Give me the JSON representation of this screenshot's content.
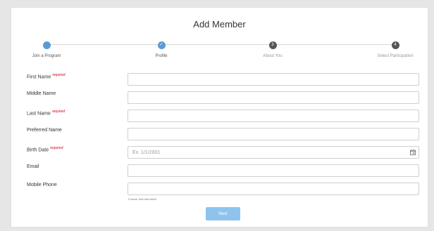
{
  "title": "Add Member",
  "steps": [
    {
      "label": "Join a Program",
      "state": "done",
      "marker": ""
    },
    {
      "label": "Profile",
      "state": "done",
      "marker": "✓"
    },
    {
      "label": "About You",
      "state": "todo",
      "marker": "3"
    },
    {
      "label": "Select Participation",
      "state": "todo",
      "marker": "4"
    }
  ],
  "form": {
    "required_text": "required",
    "fields": [
      {
        "label": "First Name",
        "value": "",
        "placeholder": ""
      },
      {
        "label": "Middle Name",
        "value": "",
        "placeholder": ""
      },
      {
        "label": "Last Name",
        "value": "",
        "placeholder": ""
      },
      {
        "label": "Preferred Name",
        "value": "",
        "placeholder": ""
      },
      {
        "label": "Birth Date",
        "value": "",
        "placeholder": "Ex. 1/1/2001"
      },
      {
        "label": "Email",
        "value": "",
        "placeholder": ""
      },
      {
        "label": "Mobile Phone",
        "value": "",
        "placeholder": ""
      }
    ],
    "phone_hint": "Format: ###-###-####"
  },
  "next_label": "Next",
  "colors": {
    "accent": "#5b9bd5",
    "button": "#8ec3ee",
    "required": "#d0021b"
  },
  "icons": {
    "calendar": "calendar-icon"
  }
}
